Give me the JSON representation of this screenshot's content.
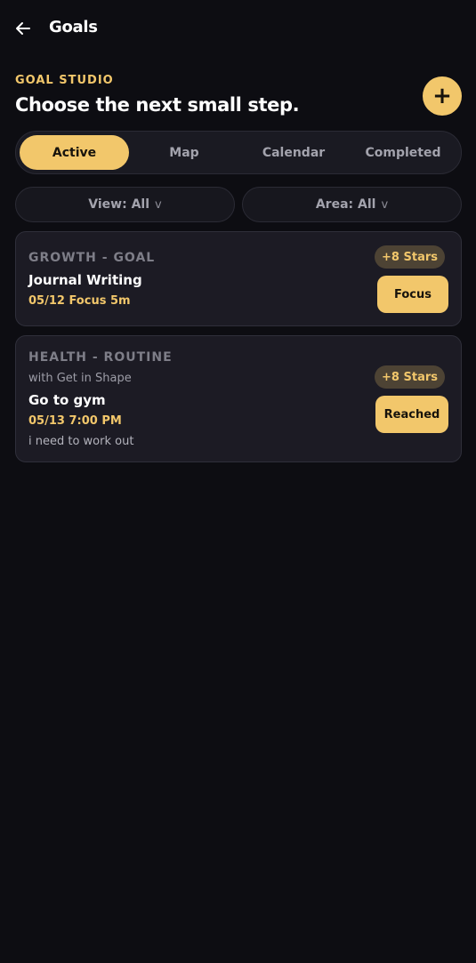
{
  "topbar": {
    "title": "Goals",
    "back_icon": "arrow-left-icon"
  },
  "header": {
    "eyebrow": "GOAL STUDIO",
    "headline": "Choose the next small step.",
    "add_label": "+"
  },
  "tabs": [
    {
      "label": "Active",
      "active": true
    },
    {
      "label": "Map",
      "active": false
    },
    {
      "label": "Calendar",
      "active": false
    },
    {
      "label": "Completed",
      "active": false
    }
  ],
  "filters": {
    "view": {
      "label": "View: All",
      "chevron": "v"
    },
    "area": {
      "label": "Area: All",
      "chevron": "v"
    }
  },
  "cards": [
    {
      "category": "GROWTH - GOAL",
      "title": "Journal Writing",
      "meta": "05/12  Focus 5m",
      "reward": "+8 Stars",
      "action": "Focus"
    },
    {
      "category": "HEALTH - ROUTINE",
      "with": "with Get in Shape",
      "title": "Go to gym",
      "meta": "05/13 7:00 PM",
      "note": "i need to work out",
      "reward": "+8 Stars",
      "action": "Reached"
    }
  ],
  "colors": {
    "background": "#0d0d12",
    "accent": "#f2c76b",
    "card": "#1c1b24",
    "badge_bg": "#4d4334"
  }
}
